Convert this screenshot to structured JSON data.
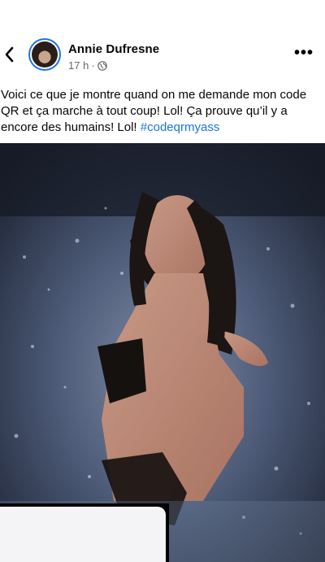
{
  "post": {
    "author": "Annie Dufresne",
    "time": "17 h",
    "separator": "·",
    "audience_icon": "globe-icon",
    "text": "Voici ce que je montre quand on me demande mon code QR et ça marche à tout coup! Lol! Ça prouve qu’il y a encore des humains! Lol!",
    "hashtag": "#codeqrmyass"
  },
  "header": {
    "back_icon": "chevron-left-icon",
    "more_icon": "more-horizontal-icon",
    "more_glyph": "•••"
  },
  "colors": {
    "link": "#1b74e4",
    "meta": "#65676b",
    "text": "#050505"
  }
}
